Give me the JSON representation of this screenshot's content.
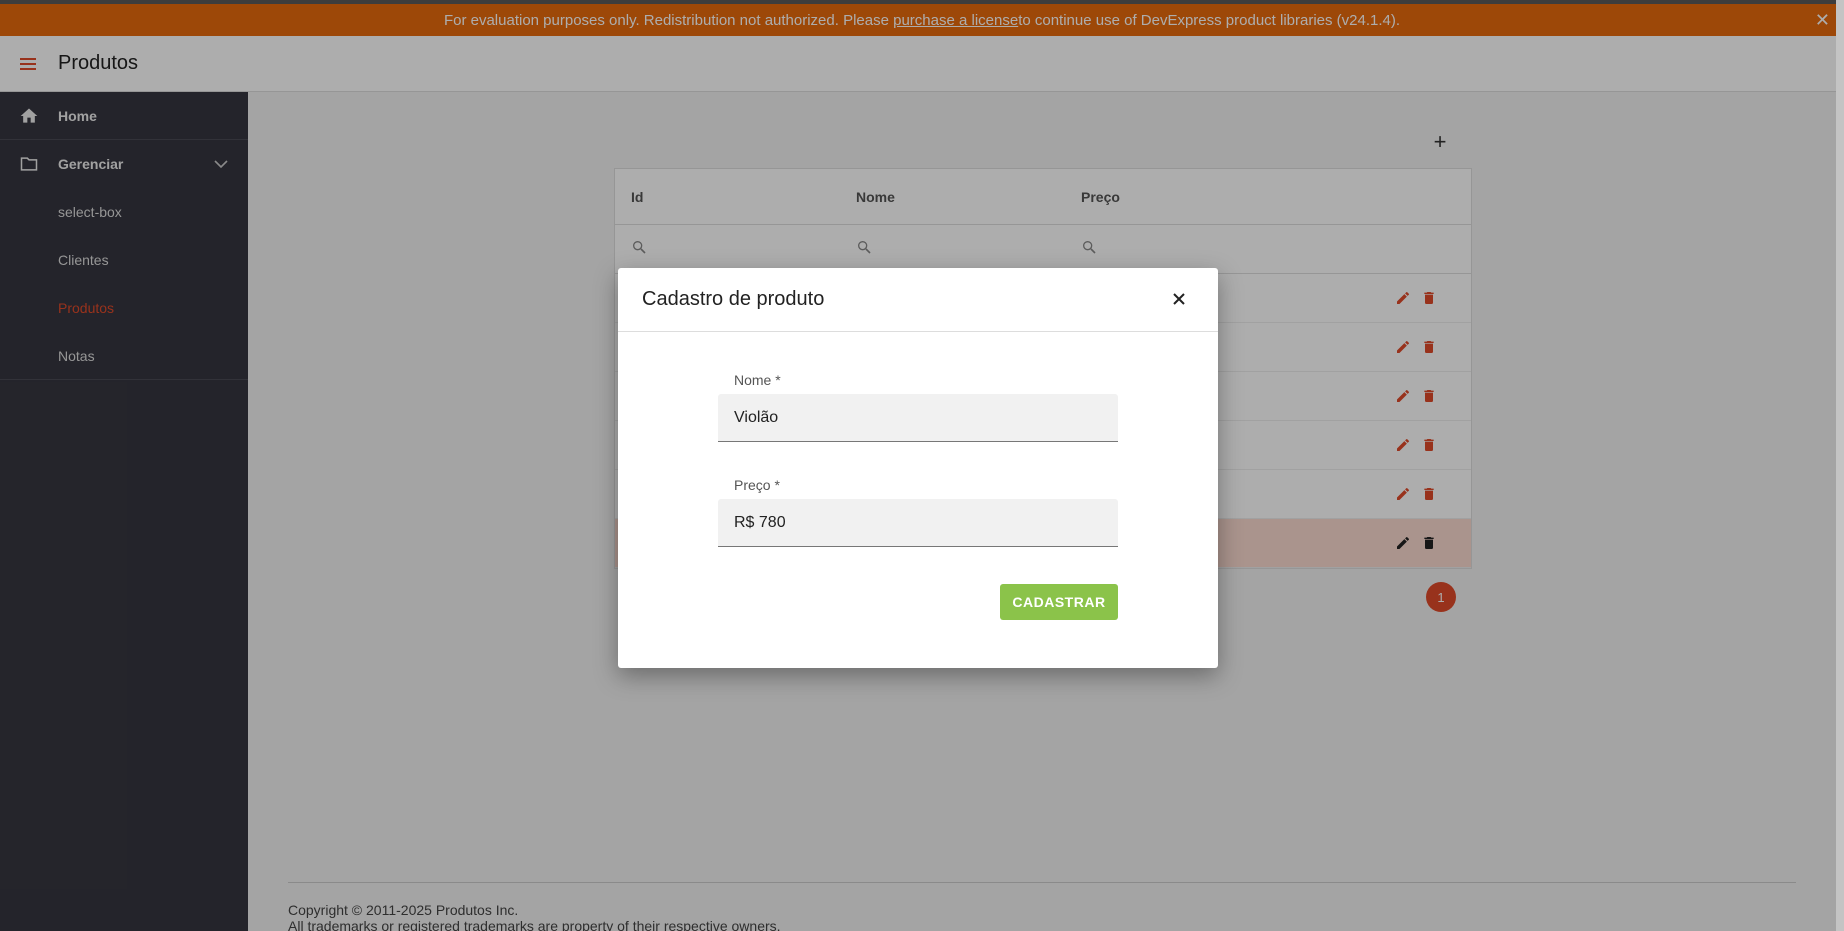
{
  "license": {
    "text_before": "For evaluation purposes only. Redistribution not authorized. Please ",
    "link": "purchase a license",
    "text_after": " to continue use of DevExpress product libraries (v24.1.4).",
    "close": "✕"
  },
  "header": {
    "title": "Produtos",
    "menu_icon": "hamburger-icon"
  },
  "sidebar": {
    "home": {
      "label": "Home",
      "icon": "home-icon"
    },
    "gerenciar": {
      "label": "Gerenciar",
      "icon": "folder-icon"
    },
    "sub_items": [
      {
        "label": "select-box"
      },
      {
        "label": "Clientes"
      },
      {
        "label": "Produtos",
        "active": true
      },
      {
        "label": "Notas"
      }
    ]
  },
  "grid": {
    "add_label": "+",
    "columns": [
      "Id",
      "Nome",
      "Preço"
    ],
    "row_count": 6,
    "selected_row": 5
  },
  "pager": {
    "current": "1"
  },
  "footer": {
    "line1": "Copyright © 2011-2025 Produtos Inc.",
    "line2": "All trademarks or registered trademarks are property of their respective owners."
  },
  "dialog": {
    "title": "Cadastro de produto",
    "nome": {
      "label": "Nome *",
      "value": "Violão"
    },
    "preco": {
      "label": "Preço *",
      "value": "R$ 780"
    },
    "submit_label": "CADASTRAR"
  },
  "colors": {
    "accent": "#e04a2a",
    "banner": "#e86a0c",
    "sidebar": "#363640",
    "submit": "#8bc34a"
  }
}
